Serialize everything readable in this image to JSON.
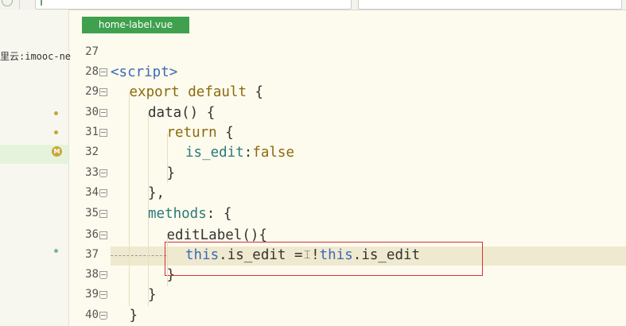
{
  "tab": {
    "filename": "home-label.vue"
  },
  "sidebar": {
    "project_path": "里云:imooc-ne"
  },
  "editor": {
    "lines": [
      {
        "n": "27",
        "segments": []
      },
      {
        "n": "28",
        "segments": [
          {
            "t": "<script>",
            "c": "tag"
          }
        ]
      },
      {
        "n": "29",
        "segments": [
          {
            "t": "export default",
            "c": "kw"
          },
          {
            "t": " {",
            "c": ""
          }
        ]
      },
      {
        "n": "30",
        "segments": [
          {
            "t": "data() {",
            "c": ""
          }
        ]
      },
      {
        "n": "31",
        "segments": [
          {
            "t": "return",
            "c": "kw"
          },
          {
            "t": " {",
            "c": ""
          }
        ]
      },
      {
        "n": "32",
        "segments": [
          {
            "t": "is_edit",
            "c": "prop"
          },
          {
            "t": ":",
            "c": ""
          },
          {
            "t": "false",
            "c": "kw"
          }
        ]
      },
      {
        "n": "33",
        "segments": [
          {
            "t": "}",
            "c": ""
          }
        ]
      },
      {
        "n": "34",
        "segments": [
          {
            "t": "},",
            "c": ""
          }
        ]
      },
      {
        "n": "35",
        "segments": [
          {
            "t": "methods",
            "c": "meth"
          },
          {
            "t": ": {",
            "c": ""
          }
        ]
      },
      {
        "n": "36",
        "segments": [
          {
            "t": "editLabel(){",
            "c": ""
          }
        ]
      },
      {
        "n": "37",
        "segments": [
          {
            "t": "this",
            "c": "this"
          },
          {
            "t": ".",
            "c": ""
          },
          {
            "t": "is_edit",
            "c": ""
          },
          {
            "t": " = ",
            "c": ""
          },
          {
            "t": "!",
            "c": ""
          },
          {
            "t": "this",
            "c": "this"
          },
          {
            "t": ".",
            "c": ""
          },
          {
            "t": "is_edit",
            "c": ""
          }
        ]
      },
      {
        "n": "38",
        "segments": [
          {
            "t": "}",
            "c": ""
          }
        ]
      },
      {
        "n": "39",
        "segments": [
          {
            "t": "}",
            "c": ""
          }
        ]
      },
      {
        "n": "40",
        "segments": [
          {
            "t": "}",
            "c": ""
          }
        ]
      }
    ]
  },
  "icons": {
    "modified_badge": "M"
  }
}
